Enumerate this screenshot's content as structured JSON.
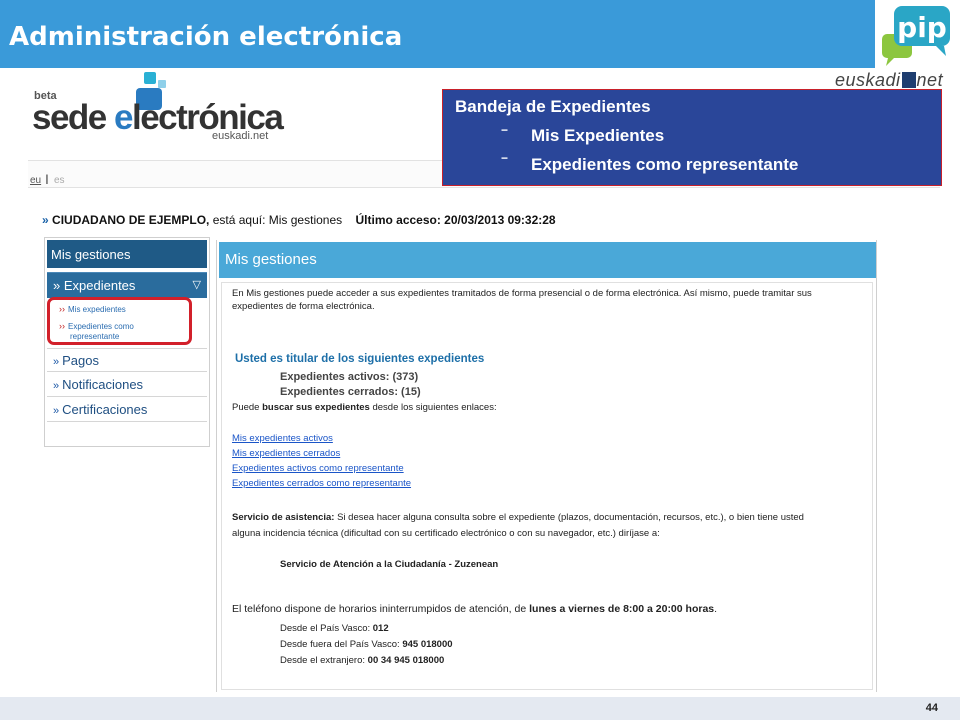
{
  "slide": {
    "title": "Administración electrónica",
    "page_number": "44"
  },
  "branding": {
    "pip_logo_text": "pip",
    "euskadi_left": "euskadi",
    "euskadi_right": "net",
    "accent_color": "#3a9ad9",
    "pip_color": "#2aa6c6"
  },
  "site_logo": {
    "beta": "beta",
    "sede": "sede",
    "e": "e",
    "lectronica": "lectrónica",
    "domain": "euskadi.net"
  },
  "language_bar": {
    "eu": "eu",
    "separator": "I",
    "es": "es"
  },
  "callout": {
    "title": "Bandeja de Expedientes",
    "items": [
      "Mis Expedientes",
      "Expedientes como representante"
    ],
    "dash": "−"
  },
  "breadcrumb": {
    "marker": "»",
    "user": "CIUDADANO DE EJEMPLO,",
    "here_label": " está aquí: ",
    "location": "Mis gestiones",
    "last_access": "Último acceso: 20/03/2013 09:32:28"
  },
  "leftnav": {
    "header": "Mis gestiones",
    "marker": "»",
    "expanded": {
      "label": "Expedientes",
      "toggle": "▽",
      "sub_marker": "››",
      "subitems": [
        "Mis expedientes",
        "Expedientes como",
        "representante"
      ]
    },
    "items": [
      "Pagos",
      "Notificaciones",
      "Certificaciones"
    ]
  },
  "content": {
    "header": "Mis gestiones",
    "intro_line1": "En Mis gestiones puede acceder a sus expedientes tramitados de forma presencial o de forma electrónica. Así mismo, puede tramitar sus",
    "intro_line2": "expedientes de forma electrónica.",
    "holder_title": "Usted es titular de los siguientes expedientes",
    "active_count": "Expedientes activos: (373)",
    "closed_count": "Expedientes cerrados: (15)",
    "search_pre": "Puede ",
    "search_bold": "buscar sus expedientes",
    "search_post": " desde los siguientes enlaces:",
    "links": [
      "Mis expedientes activos",
      "Mis expedientes cerrados",
      "Expedientes activos como representante",
      "Expedientes cerrados como representante"
    ],
    "assist_bold": "Servicio de asistencia:",
    "assist_line1": " Si desea hacer alguna consulta sobre el expediente (plazos, documentación, recursos, etc.), o bien tiene usted",
    "assist_line2": "alguna incidencia técnica (dificultad con su certificado electrónico o con su navegador, etc.) diríjase a:",
    "service_name": "Servicio de Atención a la Ciudadanía - Zuzenean",
    "phone_pre": "El teléfono dispone de horarios ininterrumpidos de atención, de ",
    "phone_bold": "lunes a viernes de 8:00 a 20:00 horas",
    "phone_post": ".",
    "contacts": [
      {
        "label": "Desde el País Vasco: ",
        "number": "012"
      },
      {
        "label": "Desde fuera del País Vasco: ",
        "number": "945 018000"
      },
      {
        "label": "Desde el extranjero: ",
        "number": "00 34 945 018000"
      }
    ]
  }
}
